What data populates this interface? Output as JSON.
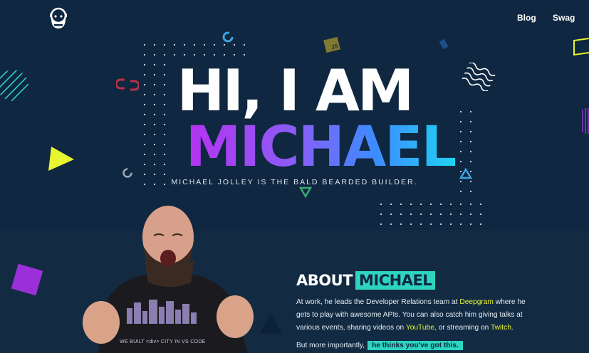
{
  "nav": {
    "blog": "Blog",
    "swag": "Swag"
  },
  "hero": {
    "line1": "HI, I AM",
    "line2": "MICHAEL",
    "tagline": "MICHAEL JOLLEY IS THE BALD BEARDED BUILDER.",
    "js_badge": "JS"
  },
  "about": {
    "title_word1": "ABOUT",
    "title_word2": "MICHAEL",
    "p1_before": "At work, he leads the Developer Relations team at ",
    "p1_link1": "Deepgram",
    "p1_mid": " where he gets to play with awesome APIs. You can also catch him giving talks at various events, sharing videos on ",
    "p1_link2": "YouTube",
    "p1_mid2": ", or streaming on ",
    "p1_link3": "Twitch",
    "p1_end": ".",
    "p2_before": "But more importantly,",
    "p2_highlight": "he thinks you've got this."
  },
  "shirt": {
    "line": "WE BUILT <div> CITY IN VS CODE"
  },
  "colors": {
    "accent_teal": "#2dd4bf",
    "accent_yellow": "#e8f531",
    "purple": "#9b30d9",
    "bg": "#0f2740"
  },
  "icons": [
    "bearded-face-logo-icon",
    "triangle-yellow",
    "square-purple",
    "circle-striped-teal",
    "wavy-lines-icon",
    "ring-icon"
  ]
}
